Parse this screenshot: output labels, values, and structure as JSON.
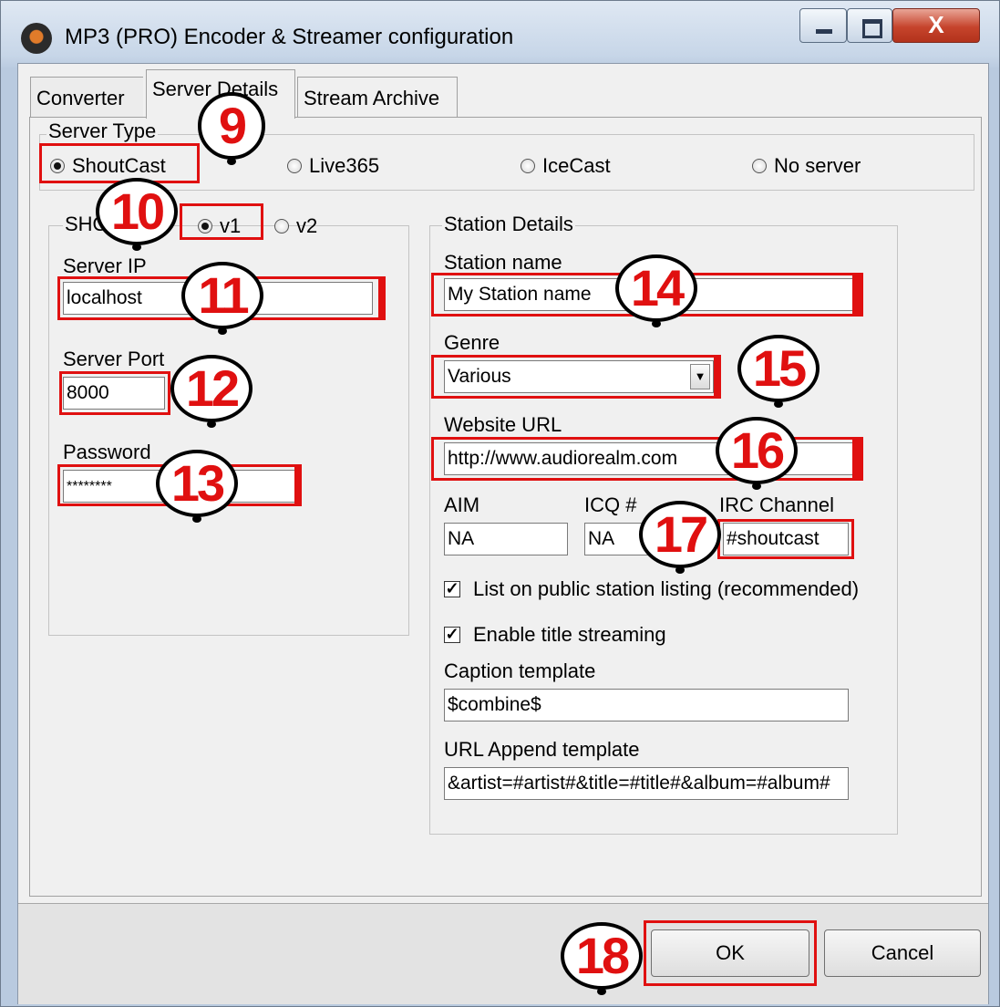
{
  "window": {
    "title": "MP3 (PRO) Encoder & Streamer configuration",
    "close_label": "X"
  },
  "tabs": [
    "Converter",
    "Server Details",
    "Stream Archive"
  ],
  "server_type": {
    "label": "Server Type",
    "options": [
      "ShoutCast",
      "Live365",
      "IceCast",
      "No server"
    ],
    "selected": "ShoutCast"
  },
  "shoutcast": {
    "group_label": "SHO",
    "versions": [
      "v1",
      "v2"
    ],
    "selected_version": "v1",
    "server_ip_label": "Server IP",
    "server_ip": "localhost",
    "server_port_label": "Server Port",
    "server_port": "8000",
    "password_label": "Password",
    "password": "********"
  },
  "station": {
    "group_label": "Station Details",
    "name_label": "Station name",
    "name": "My Station name",
    "genre_label": "Genre",
    "genre": "Various",
    "website_label": "Website URL",
    "website": "http://www.audiorealm.com",
    "aim_label": "AIM",
    "aim": "NA",
    "icq_label": "ICQ #",
    "icq": "NA",
    "irc_label": "IRC Channel",
    "irc": "#shoutcast",
    "list_public_label": "List on public station listing (recommended)",
    "list_public_checked": true,
    "title_streaming_label": "Enable title streaming",
    "title_streaming_checked": true,
    "caption_template_label": "Caption template",
    "caption_template": "$combine$",
    "url_append_label": "URL Append template",
    "url_append": "&artist=#artist#&title=#title#&album=#album#"
  },
  "buttons": {
    "ok": "OK",
    "cancel": "Cancel"
  },
  "callouts": [
    "9",
    "10",
    "11",
    "12",
    "13",
    "14",
    "15",
    "16",
    "17",
    "18"
  ],
  "colors": {
    "highlight": "#e01010",
    "titlebar": "#c7d6e8",
    "dialog": "#f0f0f0"
  }
}
